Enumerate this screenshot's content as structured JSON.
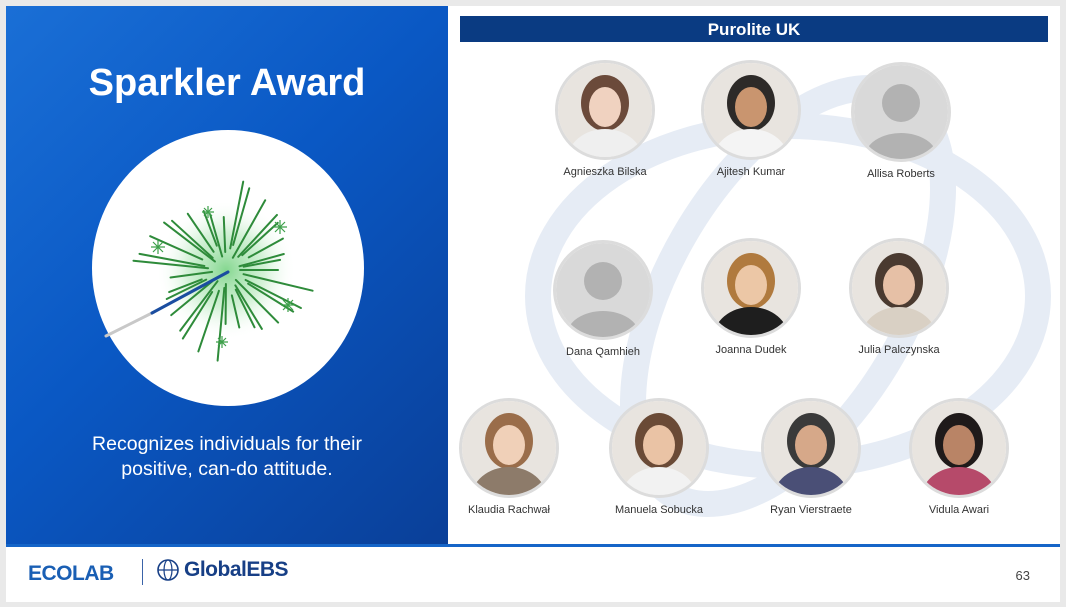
{
  "award": {
    "title": "Sparkler Award",
    "description_line1": "Recognizes individuals for their",
    "description_line2": "positive, can-do attitude.",
    "badge_icon": "sparkler-icon"
  },
  "team": {
    "header": "Purolite UK",
    "header_color": "#0a3b82",
    "members": [
      {
        "name": "Agnieszka Bilska",
        "photo": "portrait"
      },
      {
        "name": "Ajitesh Kumar",
        "photo": "portrait"
      },
      {
        "name": "Allisa Roberts",
        "photo": "placeholder-avatar"
      },
      {
        "name": "Dana Qamhieh",
        "photo": "placeholder-avatar"
      },
      {
        "name": "Joanna Dudek",
        "photo": "portrait"
      },
      {
        "name": "Julia Palczynska",
        "photo": "portrait"
      },
      {
        "name": "Klaudia Rachwał",
        "photo": "portrait"
      },
      {
        "name": "Manuela Sobucka",
        "photo": "portrait"
      },
      {
        "name": "Ryan Vierstraete",
        "photo": "portrait"
      },
      {
        "name": "Vidula Awari",
        "photo": "portrait"
      }
    ]
  },
  "footer": {
    "ecolab_logo": "ECOLAB",
    "global_logo_global": "Global",
    "global_logo_ebs": "EBS",
    "page_number": "63"
  },
  "colors": {
    "brand_blue": "#0a58c4",
    "accent_green": "#2e9e3a"
  }
}
